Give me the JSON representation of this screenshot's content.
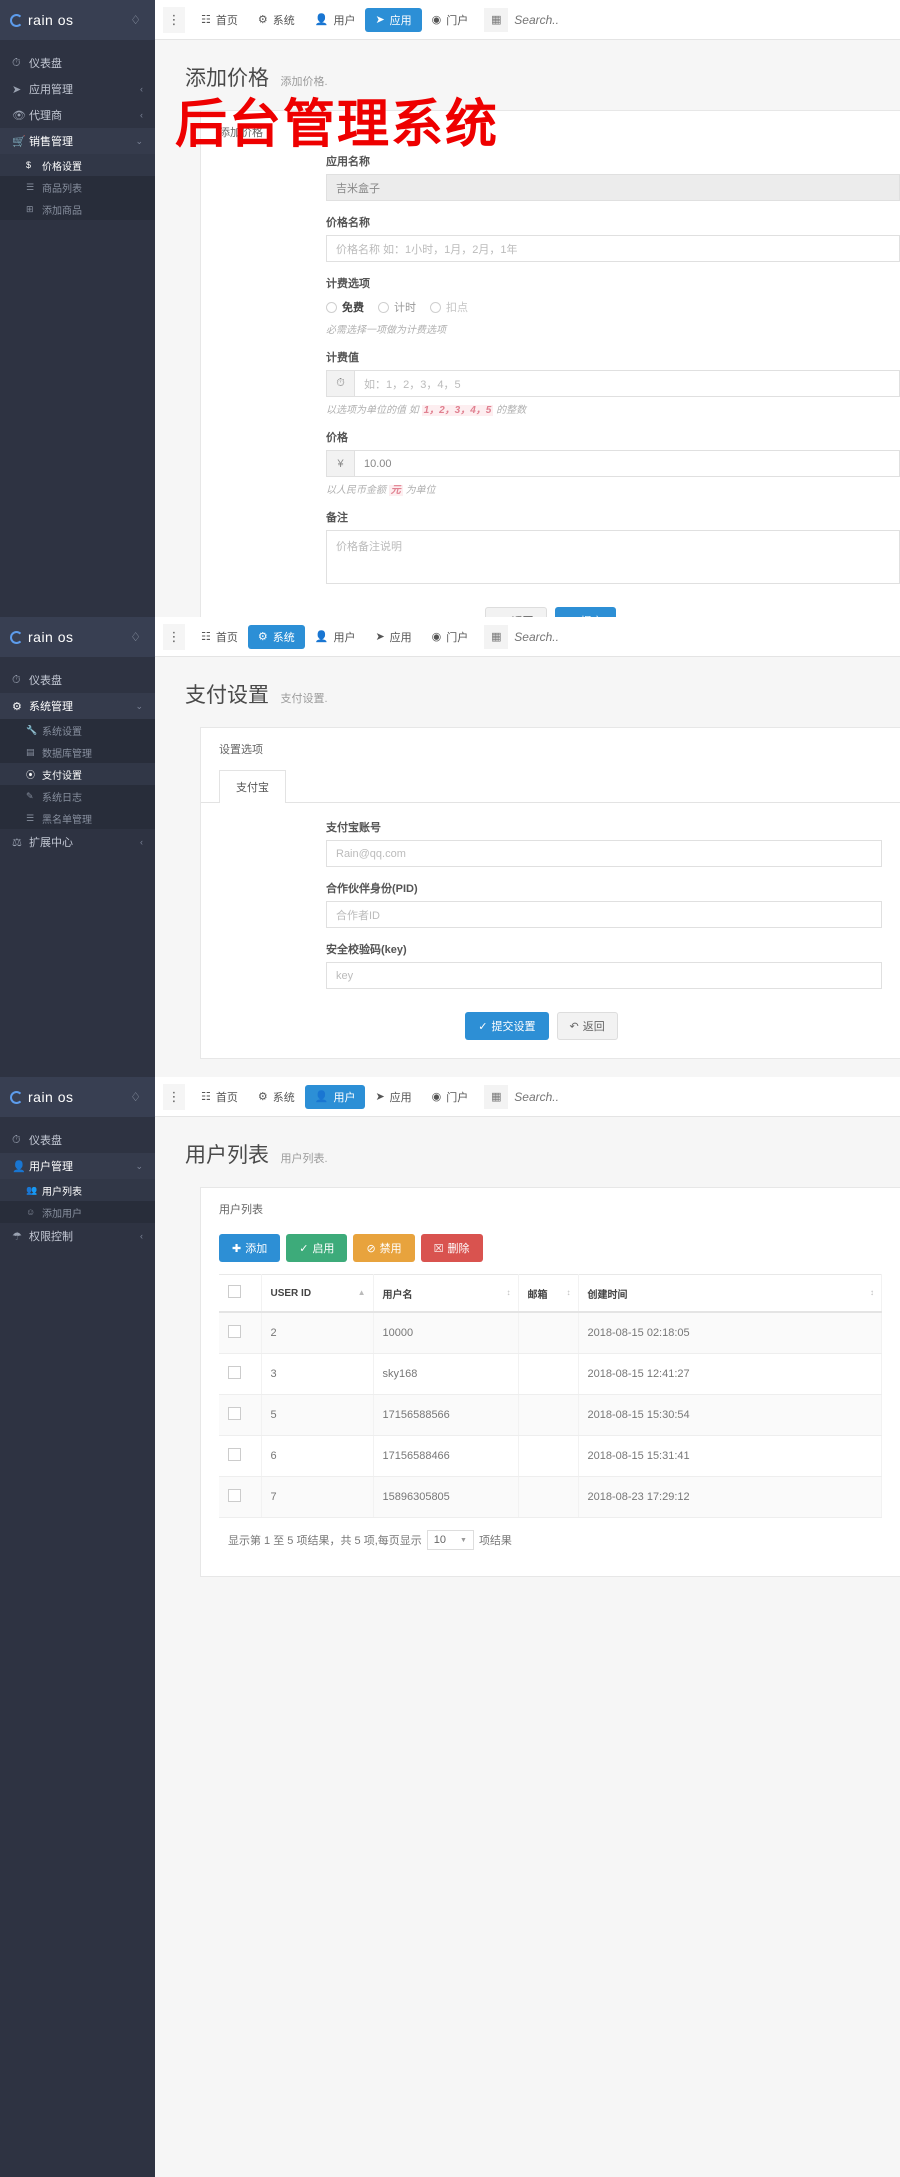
{
  "brand": {
    "name": "rain os",
    "logo_icon": "circle-logo-icon",
    "drop_icon": "droplet-icon"
  },
  "topnav": {
    "kebab_icon": "vertical-dots-icon",
    "grid_icon": "grid-icon",
    "search_placeholder": "Search..",
    "items": [
      {
        "label": "首页",
        "icon": "home-icon"
      },
      {
        "label": "系统",
        "icon": "gear-icon"
      },
      {
        "label": "用户",
        "icon": "user-icon"
      },
      {
        "label": "应用",
        "icon": "send-icon"
      },
      {
        "label": "门户",
        "icon": "globe-icon"
      }
    ]
  },
  "watermark": "后台管理系统",
  "panel1": {
    "sidebar": [
      {
        "label": "仪表盘",
        "icon": "dashboard-icon",
        "active": false,
        "caret": ""
      },
      {
        "label": "应用管理",
        "icon": "send-icon",
        "active": false,
        "caret": "‹"
      },
      {
        "label": "代理商",
        "icon": "eye-icon",
        "active": false,
        "caret": "‹"
      },
      {
        "label": "销售管理",
        "icon": "cart-icon",
        "active": true,
        "caret": "⌄"
      }
    ],
    "submenu": [
      {
        "label": "价格设置",
        "icon": "$",
        "active": true
      },
      {
        "label": "商品列表",
        "icon": "list-icon",
        "active": false
      },
      {
        "label": "添加商品",
        "icon": "plus-box-icon",
        "active": false
      }
    ],
    "active_nav": "应用",
    "page_title": "添加价格",
    "page_sub": "添加价格.",
    "card_title": "添加价格",
    "fields": [
      {
        "label": "应用名称",
        "value": "吉米盒子",
        "readonly": true
      },
      {
        "label": "价格名称",
        "placeholder": "价格名称 如：1小时，1月，2月，1年"
      }
    ],
    "billing": {
      "label": "计费选项",
      "options": [
        "免费",
        "计时",
        "扣点"
      ],
      "hint": "必需选择一项做为计费选项"
    },
    "billing_value": {
      "label": "计费值",
      "addon_icon": "clock-icon",
      "placeholder": "如：1，2，3，4，5",
      "hint_pre": "以选项为单位的值 如",
      "hint_hl": "1，2，3，4，5",
      "hint_post": "的整数"
    },
    "price": {
      "label": "价格",
      "addon": "¥",
      "value": "10.00",
      "hint_pre": "以人民币金额",
      "hint_hl": "元",
      "hint_post": "为单位"
    },
    "remark": {
      "label": "备注",
      "placeholder": "价格备注说明"
    },
    "buttons": [
      {
        "label": "返回",
        "icon": "undo-icon",
        "style": "grey"
      },
      {
        "label": "提交",
        "icon": "check-icon",
        "style": "blue"
      }
    ]
  },
  "panel2": {
    "sidebar": [
      {
        "label": "仪表盘",
        "icon": "dashboard-icon",
        "active": false,
        "caret": ""
      },
      {
        "label": "系统管理",
        "icon": "gear-icon",
        "active": true,
        "caret": "⌄"
      }
    ],
    "submenu": [
      {
        "label": "系统设置",
        "icon": "wrench-icon",
        "active": false
      },
      {
        "label": "数据库管理",
        "icon": "database-icon",
        "active": false
      },
      {
        "label": "支付设置",
        "icon": "pay-icon",
        "active": true
      },
      {
        "label": "系统日志",
        "icon": "note-icon",
        "active": false
      },
      {
        "label": "黑名单管理",
        "icon": "list-icon",
        "active": false
      }
    ],
    "sidebar_tail": [
      {
        "label": "扩展中心",
        "icon": "extension-icon",
        "active": false,
        "caret": "‹"
      }
    ],
    "active_nav": "系统",
    "page_title": "支付设置",
    "page_sub": "支付设置.",
    "card_title": "设置选项",
    "tab": "支付宝",
    "fields": [
      {
        "label": "支付宝账号",
        "placeholder": "Rain@qq.com"
      },
      {
        "label": "合作伙伴身份(PID)",
        "placeholder": "合作者ID"
      },
      {
        "label": "安全校验码(key)",
        "placeholder": "key"
      }
    ],
    "buttons": [
      {
        "label": "提交设置",
        "icon": "check-icon",
        "style": "blue"
      },
      {
        "label": "返回",
        "icon": "undo-icon",
        "style": "grey"
      }
    ]
  },
  "panel3": {
    "sidebar": [
      {
        "label": "仪表盘",
        "icon": "dashboard-icon",
        "active": false,
        "caret": ""
      },
      {
        "label": "用户管理",
        "icon": "user-icon",
        "active": true,
        "caret": "⌄"
      }
    ],
    "submenu": [
      {
        "label": "用户列表",
        "icon": "users-icon",
        "active": true
      },
      {
        "label": "添加用户",
        "icon": "user-plus-icon",
        "active": false
      }
    ],
    "sidebar_tail": [
      {
        "label": "权限控制",
        "icon": "shield-icon",
        "active": false,
        "caret": "‹"
      }
    ],
    "active_nav": "用户",
    "page_title": "用户列表",
    "page_sub": "用户列表.",
    "card_title": "用户列表",
    "toolbar": [
      {
        "label": "添加",
        "icon": "plus-icon",
        "style": "cyan"
      },
      {
        "label": "启用",
        "icon": "check-icon",
        "style": "green"
      },
      {
        "label": "禁用",
        "icon": "ban-icon",
        "style": "yellow"
      },
      {
        "label": "删除",
        "icon": "trash-icon",
        "style": "red"
      }
    ],
    "table": {
      "columns": [
        "",
        "USER ID",
        "用户名",
        "邮箱",
        "创建时间",
        ""
      ],
      "rows": [
        {
          "id": "2",
          "username": "10000",
          "email": "",
          "created": "2018-08-15 02:18:05"
        },
        {
          "id": "3",
          "username": "sky168",
          "email": "",
          "created": "2018-08-15 12:41:27"
        },
        {
          "id": "5",
          "username": "17156588566",
          "email": "",
          "created": "2018-08-15 15:30:54"
        },
        {
          "id": "6",
          "username": "17156588466",
          "email": "",
          "created": "2018-08-15 15:31:41"
        },
        {
          "id": "7",
          "username": "15896305805",
          "email": "",
          "created": "2018-08-23 17:29:12"
        }
      ],
      "footer_pre": "显示第 1 至 5 项结果，共 5 项,每页显示",
      "page_size": "10",
      "footer_post": "项结果"
    }
  }
}
